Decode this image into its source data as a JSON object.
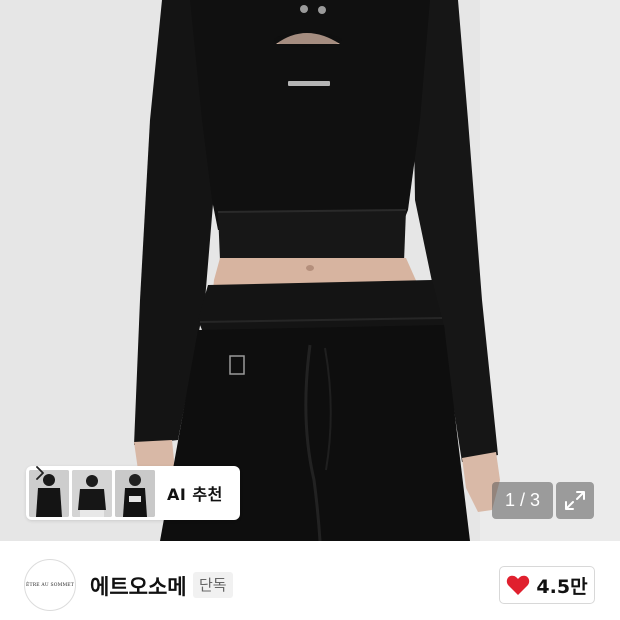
{
  "gallery": {
    "pager_text": "1 / 3",
    "ai_recommend_label": "AI 추천",
    "thumbnail_count": 3
  },
  "brand": {
    "logo_text": "ÊTRE AU SOMMET",
    "name": "에트오소메",
    "badge": "단독"
  },
  "like": {
    "count": "4.5만",
    "color": "#e0202e"
  },
  "icons": [
    "chevron-right-icon",
    "expand-icon",
    "heart-icon"
  ]
}
